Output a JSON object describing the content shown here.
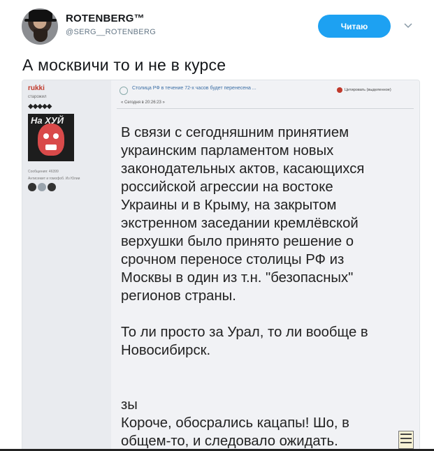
{
  "tweet": {
    "display_name": "ROTENBERG™",
    "handle": "@SERG__ROTENBERG",
    "follow_label": "Читаю",
    "text": "А москвичи то и не в курсе"
  },
  "forum": {
    "poster": {
      "name": "rukki",
      "rank": "старожил",
      "rank_icons": "◆◆◆◆◆",
      "avatar_text": "На ХУЙ",
      "messages": "Сообщения: 46399",
      "location": "Антисемит и гомофоб. Из Юлии"
    },
    "thread": {
      "title": "Столица РФ в течение 72-х часов будет перенесена ...",
      "date": "« Сегодня в 20:26:23 »",
      "quote_label": "Цитировать (выделенное)"
    },
    "post_lines": [
      "В связи с сегодняшним принятием",
      "украинским парламентом новых",
      "законодательных актов, касающихся",
      "российской агрессии на востоке",
      "Украины и в Крыму, на закрытом",
      "экстренном заседании кремлёвской",
      "верхушки было принято решение о",
      "срочном переносе столицы РФ из",
      "Москвы в один из т.н. \"безопасных\"",
      "регионов страны."
    ],
    "post_lines_2": [
      "То ли просто за Урал, то ли вообще в",
      "Новосибирск."
    ],
    "post_lines_3": [
      "зы",
      "Короче, обосрались кацапы! Шо, в",
      "общем-то, и следовало ожидать."
    ]
  },
  "colors": {
    "follow_button": "#1da1f2",
    "poster_name": "#c0392b",
    "thread_link": "#3b6ea5"
  }
}
